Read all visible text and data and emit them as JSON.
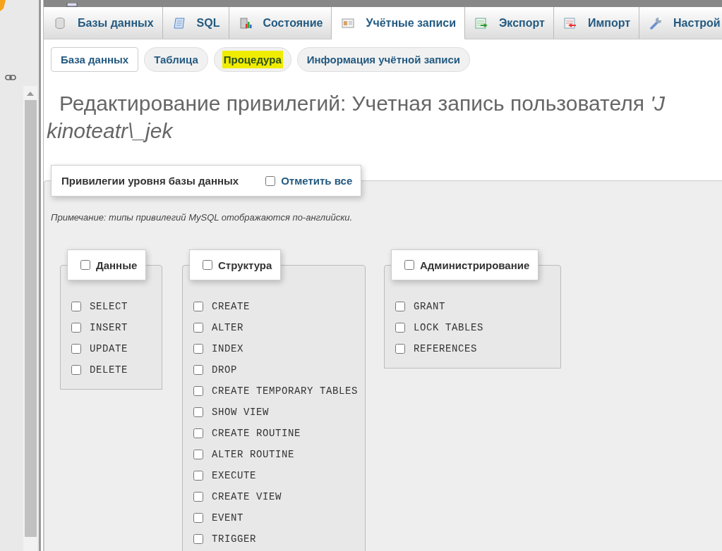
{
  "tabs": [
    {
      "label": "Базы данных",
      "selected": false
    },
    {
      "label": "SQL",
      "selected": false
    },
    {
      "label": "Состояние",
      "selected": false
    },
    {
      "label": "Учётные записи",
      "selected": true
    },
    {
      "label": "Экспорт",
      "selected": false
    },
    {
      "label": "Импорт",
      "selected": false
    },
    {
      "label": "Настрой",
      "selected": false
    }
  ],
  "subtabs": [
    {
      "label": "База данных",
      "selected": true,
      "highlighted": false
    },
    {
      "label": "Таблица",
      "selected": false,
      "highlighted": false
    },
    {
      "label": "Процедура",
      "selected": false,
      "highlighted": true
    },
    {
      "label": "Информация учётной записи",
      "selected": false,
      "highlighted": false
    }
  ],
  "heading": {
    "line_1": "Редактирование привилегий: Учетная запись пользователя *'J*",
    "line_2": "kinoteatr\\_jek"
  },
  "privileges": {
    "legend": "Привилегии уровня базы данных",
    "select_all": {
      "label": "Отметить все",
      "checked": false
    },
    "note": "Примечание: типы привилегий MySQL отображаются по-английски.",
    "groups": [
      {
        "title": "Данные",
        "checked": false,
        "items": [
          {
            "label": "SELECT",
            "checked": false
          },
          {
            "label": "INSERT",
            "checked": false
          },
          {
            "label": "UPDATE",
            "checked": false
          },
          {
            "label": "DELETE",
            "checked": false
          }
        ]
      },
      {
        "title": "Структура",
        "checked": false,
        "items": [
          {
            "label": "CREATE",
            "checked": false
          },
          {
            "label": "ALTER",
            "checked": false
          },
          {
            "label": "INDEX",
            "checked": false
          },
          {
            "label": "DROP",
            "checked": false
          },
          {
            "label": "CREATE TEMPORARY TABLES",
            "checked": false
          },
          {
            "label": "SHOW VIEW",
            "checked": false
          },
          {
            "label": "CREATE ROUTINE",
            "checked": false
          },
          {
            "label": "ALTER ROUTINE",
            "checked": false
          },
          {
            "label": "EXECUTE",
            "checked": false
          },
          {
            "label": "CREATE VIEW",
            "checked": false
          },
          {
            "label": "EVENT",
            "checked": false
          },
          {
            "label": "TRIGGER",
            "checked": false
          }
        ]
      },
      {
        "title": "Администрирование",
        "checked": false,
        "items": [
          {
            "label": "GRANT",
            "checked": false
          },
          {
            "label": "LOCK TABLES",
            "checked": false
          },
          {
            "label": "REFERENCES",
            "checked": false
          }
        ]
      }
    ]
  }
}
